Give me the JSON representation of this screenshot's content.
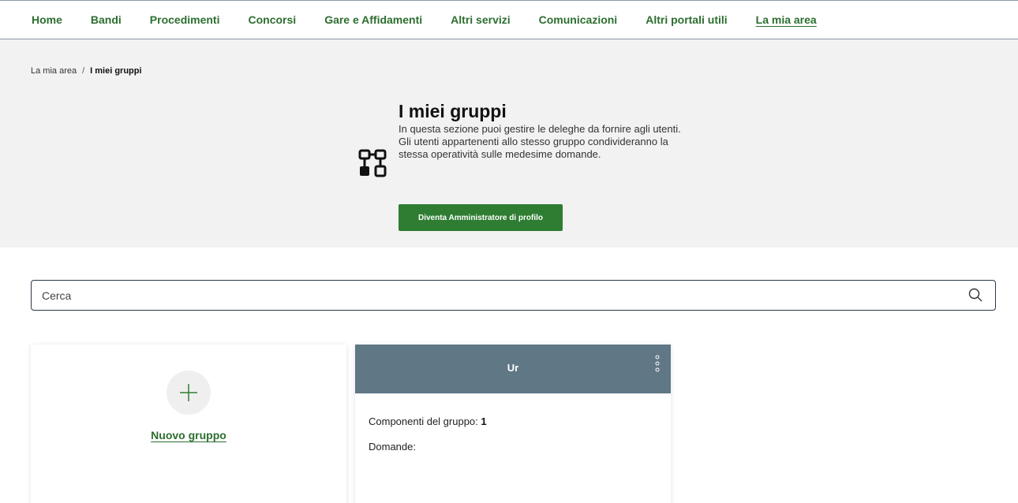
{
  "nav": {
    "items": [
      {
        "label": "Home"
      },
      {
        "label": "Bandi"
      },
      {
        "label": "Procedimenti"
      },
      {
        "label": "Concorsi"
      },
      {
        "label": "Gare e Affidamenti"
      },
      {
        "label": "Altri servizi"
      },
      {
        "label": "Comunicazioni"
      },
      {
        "label": "Altri portali utili"
      },
      {
        "label": "La mia area",
        "active": true
      }
    ]
  },
  "breadcrumb": {
    "parent": "La mia area",
    "separator": "/",
    "current": "I miei gruppi"
  },
  "hero": {
    "icon": "groups-diagram-icon",
    "title": "I miei gruppi",
    "desc_line1": "In questa sezione puoi gestire le deleghe da fornire agli utenti.",
    "desc_line2": "Gli utenti appartenenti allo stesso gruppo condivideranno la stessa operatività sulle medesime domande.",
    "admin_button": "Diventa Amministratore di profilo"
  },
  "search": {
    "placeholder": "Cerca",
    "icon": "search-icon"
  },
  "new_group": {
    "icon": "plus-icon",
    "label": "Nuovo gruppo"
  },
  "groups": [
    {
      "name": "Ur",
      "members_label": "Componenti del gruppo:",
      "members_count": "1",
      "requests_label": "Domande:"
    }
  ],
  "colors": {
    "accent_green": "#2e7d32",
    "link_green": "#2c6e2f",
    "group_header": "#607786",
    "hero_bg": "#f2f2f2"
  }
}
